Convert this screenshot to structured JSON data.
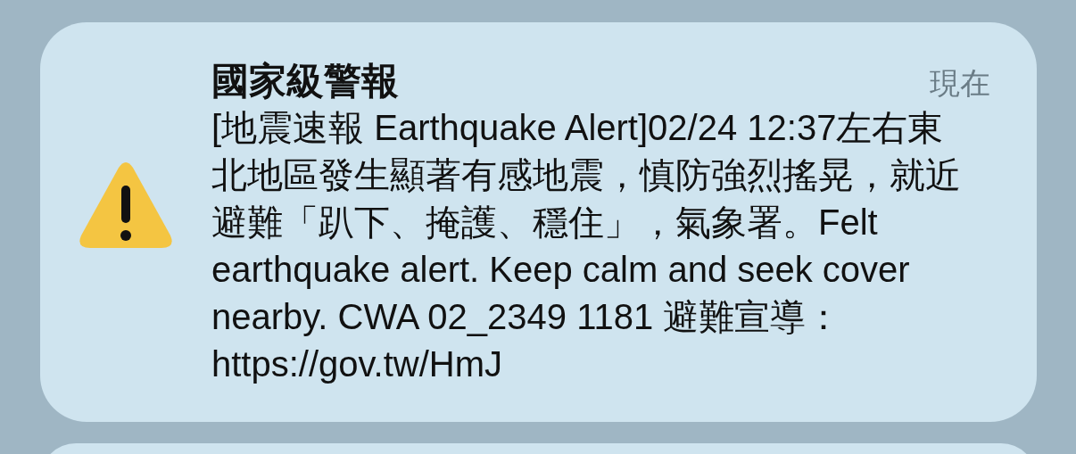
{
  "notification": {
    "app_name": "國家級警報",
    "time": "現在",
    "message": "[地震速報 Earthquake Alert]02/24 12:37左右東北地區發生顯著有感地震，慎防強烈搖晃，就近避難「趴下、掩護、穩住」，氣象署。Felt earthquake alert. Keep calm and seek cover nearby. CWA 02_2349 1181 避難宣導：https://gov.tw/HmJ"
  }
}
